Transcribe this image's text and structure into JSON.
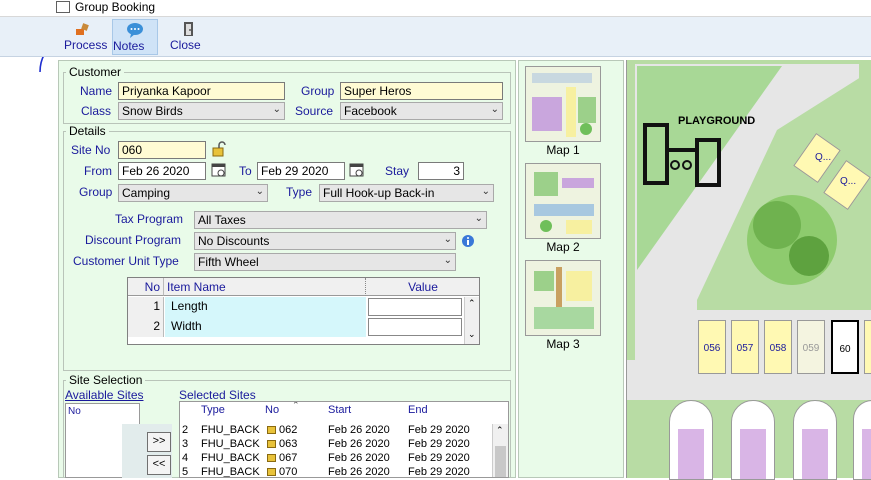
{
  "window": {
    "title": "Group Booking"
  },
  "toolbar": {
    "process_label": "Process",
    "notes_label": "Notes",
    "close_label": "Close"
  },
  "customer": {
    "section_title": "Customer",
    "name_label": "Name",
    "name_value": "Priyanka Kapoor",
    "group_label": "Group",
    "group_value": "Super Heros",
    "class_label": "Class",
    "class_value": "Snow Birds",
    "source_label": "Source",
    "source_value": "Facebook"
  },
  "details": {
    "section_title": "Details",
    "site_no_label": "Site No",
    "site_no_value": "060",
    "from_label": "From",
    "from_value": "Feb 26 2020",
    "to_label": "To",
    "to_value": "Feb 29 2020",
    "stay_label": "Stay",
    "stay_value": "3",
    "group_label": "Group",
    "group_value": "Camping",
    "type_label": "Type",
    "type_value": "Full Hook-up Back-in",
    "tax_label": "Tax Program",
    "tax_value": "All Taxes",
    "discount_label": "Discount Program",
    "discount_value": "No Discounts",
    "unit_type_label": "Customer Unit Type",
    "unit_type_value": "Fifth Wheel"
  },
  "items_grid": {
    "columns": {
      "no": "No",
      "name": "Item Name",
      "value": "Value"
    },
    "rows": [
      {
        "no": "1",
        "name": "Length",
        "value": ""
      },
      {
        "no": "2",
        "name": "Width",
        "value": ""
      }
    ]
  },
  "site_selection": {
    "section_title": "Site Selection",
    "available_label": "Available Sites",
    "available_col_no": "No",
    "add_button": ">>",
    "remove_button": "<<",
    "selected_label": "Selected Sites",
    "columns": {
      "type": "Type",
      "no": "No",
      "start": "Start",
      "end": "End"
    },
    "rows": [
      {
        "idx": "2",
        "type": "FHU_BACK",
        "no": "062",
        "start": "Feb 26 2020",
        "end": "Feb 29 2020"
      },
      {
        "idx": "3",
        "type": "FHU_BACK",
        "no": "063",
        "start": "Feb 26 2020",
        "end": "Feb 29 2020"
      },
      {
        "idx": "4",
        "type": "FHU_BACK",
        "no": "067",
        "start": "Feb 26 2020",
        "end": "Feb 29 2020"
      },
      {
        "idx": "5",
        "type": "FHU_BACK",
        "no": "070",
        "start": "Feb 26 2020",
        "end": "Feb 29 2020"
      }
    ]
  },
  "maps": {
    "thumbs": [
      "Map 1",
      "Map 2",
      "Map 3"
    ],
    "playground_label": "PLAYGROUND",
    "q_labels": [
      "Q...",
      "Q..."
    ],
    "sites": [
      "056",
      "057",
      "058",
      "059",
      "60"
    ],
    "bottom_sites": [
      "",
      "",
      "",
      ""
    ]
  },
  "colors": {
    "panel_bg": "#e9fbe9",
    "field_yellow": "#fffbd4",
    "label_blue": "#1a1a9c",
    "toolbar_bg": "#e8f0f8",
    "site_yellow": "#fff9b3",
    "grass": "#b6dca0"
  }
}
